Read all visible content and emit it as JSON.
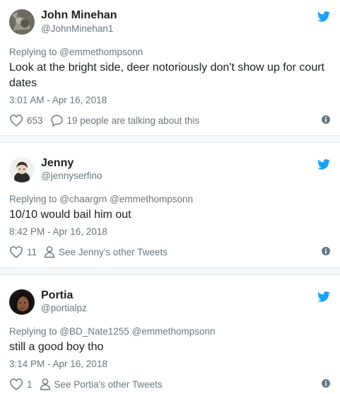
{
  "tweets": [
    {
      "name": "John Minehan",
      "handle": "@JohnMinehan1",
      "replying_to": "Replying to @emmethompsonn",
      "text": "Look at the bright side, deer notoriously don't show up for court dates",
      "time": "3:01 AM - Apr 16, 2018",
      "likes": "653",
      "secondary": "19 people are talking about this",
      "secondary_icon": "reply-bubble-icon"
    },
    {
      "name": "Jenny",
      "handle": "@jennyserfino",
      "replying_to": "Replying to @chaargrn @emmethompsonn",
      "text": "10/10 would bail him out",
      "time": "8:42 PM - Apr 16, 2018",
      "likes": "11",
      "secondary": "See Jenny's other Tweets",
      "secondary_icon": "person-icon"
    },
    {
      "name": "Portia",
      "handle": "@portialpz",
      "replying_to": "Replying to @BD_Nate1255 @emmethompsonn",
      "text": "still a good boy tho",
      "time": "3:14 PM - Apr 16, 2018",
      "likes": "1",
      "secondary": "See Portia's other Tweets",
      "secondary_icon": "person-icon"
    }
  ],
  "colors": {
    "twitter_blue": "#1da1f2",
    "text": "#1c2022",
    "muted": "#697882",
    "divider": "#e1e8ed"
  }
}
